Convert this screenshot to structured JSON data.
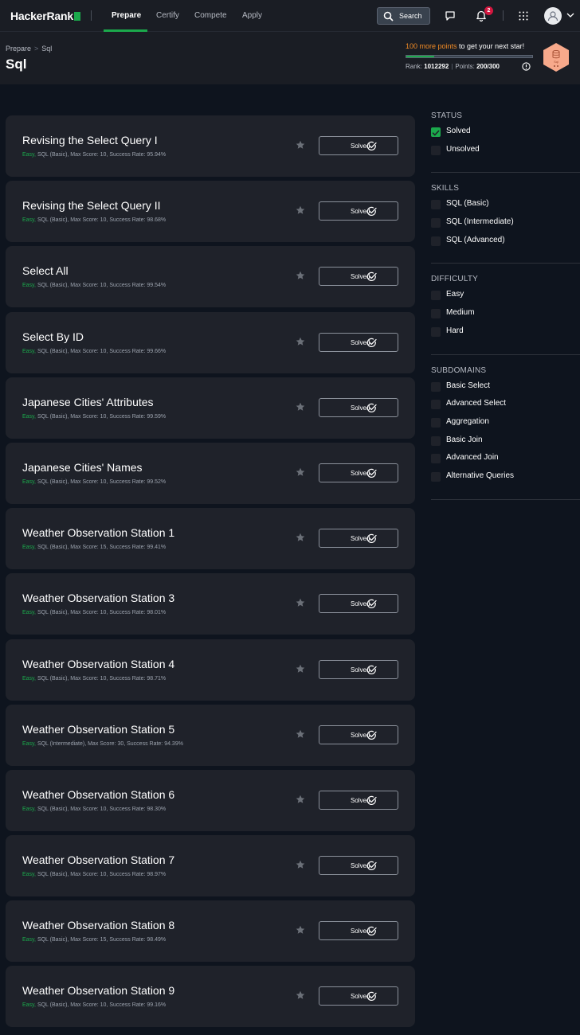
{
  "nav": {
    "logo": "HackerRank",
    "links": [
      "Prepare",
      "Certify",
      "Compete",
      "Apply"
    ],
    "search_label": "Search",
    "notification_count": "2"
  },
  "header": {
    "breadcrumb": [
      "Prepare",
      "Sql"
    ],
    "title": "Sql",
    "points_needed": "100 more points",
    "points_suffix": " to get your next star!",
    "progress_fraction": 0.22,
    "rank_label": "Rank:",
    "rank_value": "1012292",
    "points_label": "Points:",
    "points_value": "200/300",
    "badge_text": "Sql"
  },
  "challenges": [
    {
      "title": "Revising the Select Query I",
      "difficulty": "Easy,",
      "meta": " SQL (Basic), Max Score: 10, Success Rate: 95.94%",
      "status": "Solved"
    },
    {
      "title": "Revising the Select Query II",
      "difficulty": "Easy,",
      "meta": " SQL (Basic), Max Score: 10, Success Rate: 98.68%",
      "status": "Solved"
    },
    {
      "title": "Select All",
      "difficulty": "Easy,",
      "meta": " SQL (Basic), Max Score: 10, Success Rate: 99.54%",
      "status": "Solved"
    },
    {
      "title": "Select By ID",
      "difficulty": "Easy,",
      "meta": " SQL (Basic), Max Score: 10, Success Rate: 99.66%",
      "status": "Solved"
    },
    {
      "title": "Japanese Cities' Attributes",
      "difficulty": "Easy,",
      "meta": " SQL (Basic), Max Score: 10, Success Rate: 99.59%",
      "status": "Solved"
    },
    {
      "title": "Japanese Cities' Names",
      "difficulty": "Easy,",
      "meta": " SQL (Basic), Max Score: 10, Success Rate: 99.52%",
      "status": "Solved"
    },
    {
      "title": "Weather Observation Station 1",
      "difficulty": "Easy,",
      "meta": " SQL (Basic), Max Score: 15, Success Rate: 99.41%",
      "status": "Solved"
    },
    {
      "title": "Weather Observation Station 3",
      "difficulty": "Easy,",
      "meta": " SQL (Basic), Max Score: 10, Success Rate: 98.01%",
      "status": "Solved"
    },
    {
      "title": "Weather Observation Station 4",
      "difficulty": "Easy,",
      "meta": " SQL (Basic), Max Score: 10, Success Rate: 98.71%",
      "status": "Solved"
    },
    {
      "title": "Weather Observation Station 5",
      "difficulty": "Easy,",
      "meta": " SQL (Intermediate), Max Score: 30, Success Rate: 94.39%",
      "status": "Solved"
    },
    {
      "title": "Weather Observation Station 6",
      "difficulty": "Easy,",
      "meta": " SQL (Basic), Max Score: 10, Success Rate: 98.30%",
      "status": "Solved"
    },
    {
      "title": "Weather Observation Station 7",
      "difficulty": "Easy,",
      "meta": " SQL (Basic), Max Score: 10, Success Rate: 98.97%",
      "status": "Solved"
    },
    {
      "title": "Weather Observation Station 8",
      "difficulty": "Easy,",
      "meta": " SQL (Basic), Max Score: 15, Success Rate: 98.49%",
      "status": "Solved"
    },
    {
      "title": "Weather Observation Station 9",
      "difficulty": "Easy,",
      "meta": " SQL (Basic), Max Score: 10, Success Rate: 99.16%",
      "status": "Solved"
    }
  ],
  "filters": [
    {
      "heading": "STATUS",
      "items": [
        {
          "label": "Solved",
          "checked": true
        },
        {
          "label": "Unsolved",
          "checked": false
        }
      ]
    },
    {
      "heading": "SKILLS",
      "items": [
        {
          "label": "SQL (Basic)",
          "checked": false
        },
        {
          "label": "SQL (Intermediate)",
          "checked": false
        },
        {
          "label": "SQL (Advanced)",
          "checked": false
        }
      ]
    },
    {
      "heading": "DIFFICULTY",
      "items": [
        {
          "label": "Easy",
          "checked": false
        },
        {
          "label": "Medium",
          "checked": false
        },
        {
          "label": "Hard",
          "checked": false
        }
      ]
    },
    {
      "heading": "SUBDOMAINS",
      "items": [
        {
          "label": "Basic Select",
          "checked": false
        },
        {
          "label": "Advanced Select",
          "checked": false
        },
        {
          "label": "Aggregation",
          "checked": false
        },
        {
          "label": "Basic Join",
          "checked": false
        },
        {
          "label": "Advanced Join",
          "checked": false
        },
        {
          "label": "Alternative Queries",
          "checked": false
        }
      ]
    }
  ],
  "colors": {
    "brand_green": "#1ba94c",
    "accent_orange": "#f08a24",
    "badge_red": "#d3173f"
  }
}
